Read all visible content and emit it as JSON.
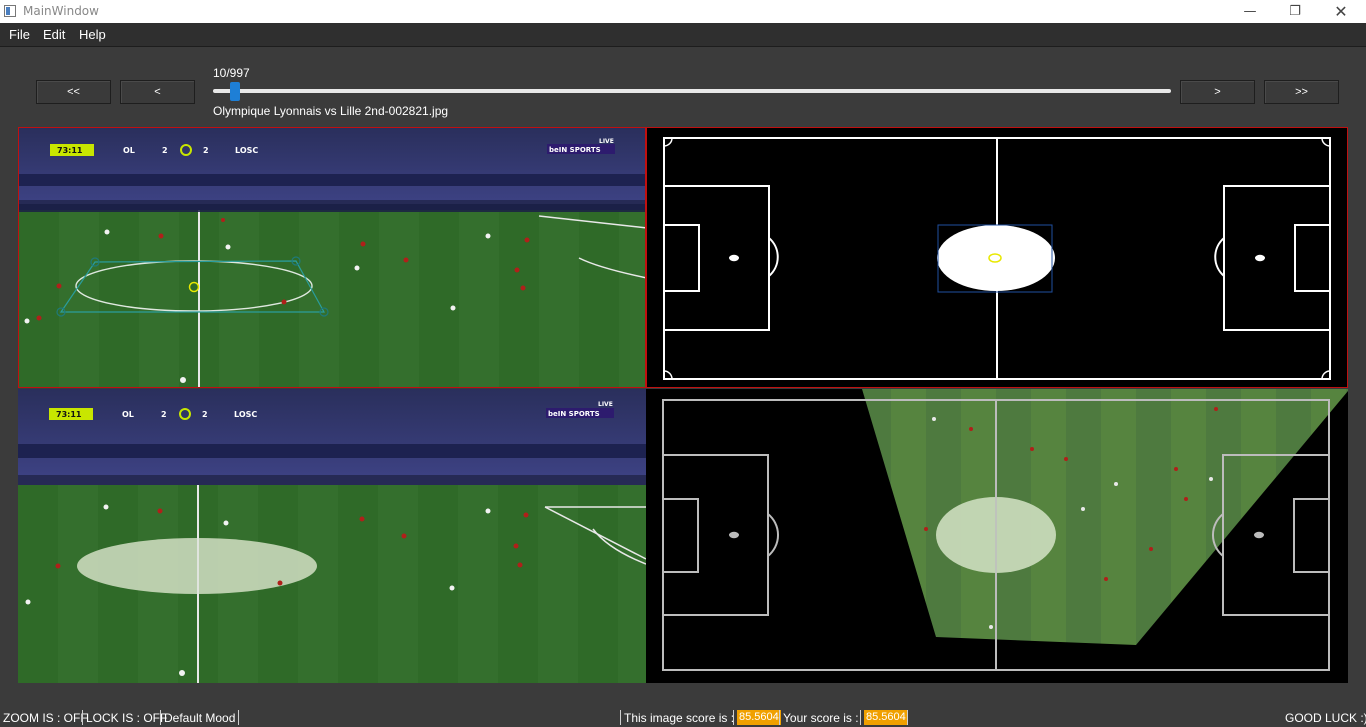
{
  "window": {
    "title": "MainWindow"
  },
  "menu": {
    "file": "File",
    "edit": "Edit",
    "help": "Help"
  },
  "nav": {
    "first": "<<",
    "prev": "<",
    "next": ">",
    "last": ">>"
  },
  "frame": {
    "counter": "10/997",
    "current": 10,
    "total": 997,
    "filename": "Olympique Lyonnais vs Lille 2nd-002821.jpg"
  },
  "broadcast": {
    "clock": "73:11",
    "home": "OL",
    "home_score": "2",
    "away_score": "2",
    "away": "LOSC",
    "network": "beIN SPORTS",
    "live": "LIVE"
  },
  "status": {
    "zoom": "ZOOM IS : OFF",
    "lock": "LOCK IS : OFF",
    "mood": "Default Mood",
    "image_score_label": "This image score is :",
    "image_score": "85.5604",
    "your_score_label": "Your score is :",
    "your_score": "85.5604",
    "good_luck": "GOOD LUCK :)"
  },
  "colors": {
    "slider": "#1e7fd6",
    "score_badge": "#f0a000",
    "panel_border": "#c01010",
    "pitch": "#2f6a28",
    "keypoint": "#1f7a7a"
  }
}
